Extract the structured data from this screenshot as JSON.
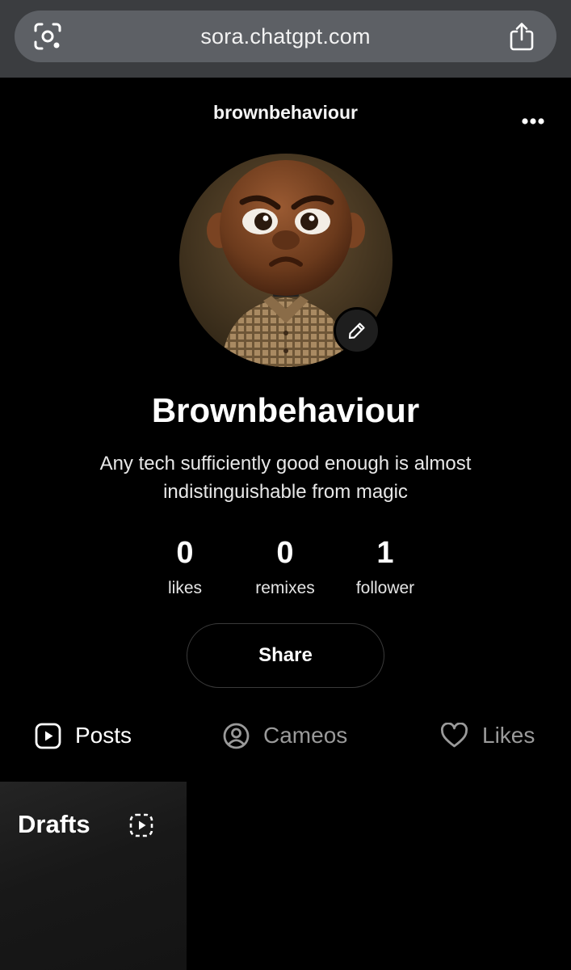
{
  "browser": {
    "url": "sora.chatgpt.com"
  },
  "profile": {
    "username": "brownbehaviour",
    "display_name": "Brownbehaviour",
    "bio": "Any tech sufficiently good enough is almost indistinguishable from magic"
  },
  "stats": [
    {
      "value": "0",
      "label": "likes"
    },
    {
      "value": "0",
      "label": "remixes"
    },
    {
      "value": "1",
      "label": "follower"
    }
  ],
  "share_button": {
    "label": "Share"
  },
  "tabs": [
    {
      "label": "Posts",
      "icon": "play-square-icon",
      "active": true
    },
    {
      "label": "Cameos",
      "icon": "user-circle-icon",
      "active": false
    },
    {
      "label": "Likes",
      "icon": "heart-icon",
      "active": false
    }
  ],
  "grid": {
    "drafts_label": "Drafts",
    "drafts_icon": "dashed-play-icon"
  },
  "colors": {
    "background": "#000000",
    "browser_bar": "#3b3d40",
    "url_pill": "#5d6065",
    "inactive_tab": "#9a9a9a"
  }
}
